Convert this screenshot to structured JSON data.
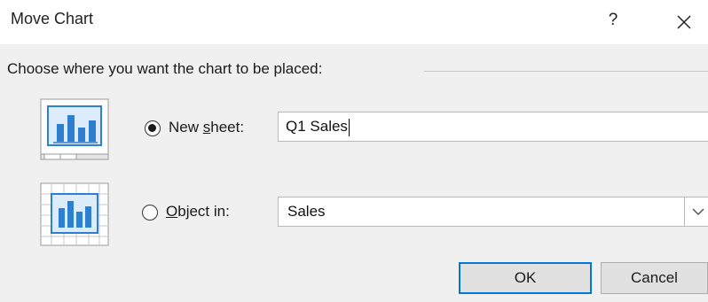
{
  "window": {
    "title": "Move Chart",
    "help_label": "?"
  },
  "section": {
    "label": "Choose where you want the chart to be placed:"
  },
  "options": {
    "new_sheet": {
      "label_before": "New ",
      "label_accel": "s",
      "label_after": "heet:",
      "selected": true,
      "value": "Q1 Sales"
    },
    "object_in": {
      "label_accel": "O",
      "label_after": "bject in:",
      "selected": false,
      "value": "Sales"
    }
  },
  "buttons": {
    "ok": "OK",
    "cancel": "Cancel"
  },
  "colors": {
    "dialog_background": "#f0f0f0",
    "titlebar_background": "#ffffff",
    "focus_border": "#0078d7",
    "icon_blue": "#2f7fd0",
    "icon_light_blue": "#cfe3f7"
  },
  "icons": {
    "new_sheet": "chart-sheet-icon",
    "object_in": "embedded-chart-icon",
    "close": "close-icon",
    "dropdown": "chevron-down-icon"
  }
}
